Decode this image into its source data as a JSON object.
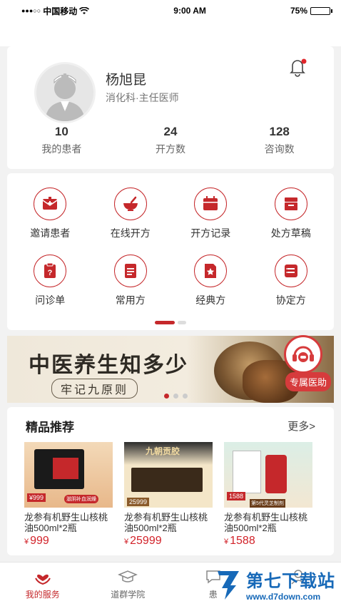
{
  "status_bar": {
    "signal": "●●●○○",
    "carrier": "中国移动",
    "time": "9:00 AM",
    "battery": "75%",
    "battery_level": 0.75
  },
  "profile": {
    "name": "杨旭昆",
    "title": "消化科·主任医师",
    "stats": [
      {
        "value": "10",
        "label": "我的患者"
      },
      {
        "value": "24",
        "label": "开方数"
      },
      {
        "value": "128",
        "label": "咨询数"
      }
    ]
  },
  "menu": [
    {
      "label": "邀请患者",
      "icon": "invite-patient-icon"
    },
    {
      "label": "在线开方",
      "icon": "mortar-bowl-icon"
    },
    {
      "label": "开方记录",
      "icon": "calendar-record-icon"
    },
    {
      "label": "处方草稿",
      "icon": "draft-box-icon"
    },
    {
      "label": "问诊单",
      "icon": "question-form-icon"
    },
    {
      "label": "常用方",
      "icon": "document-lines-icon"
    },
    {
      "label": "经典方",
      "icon": "star-document-icon"
    },
    {
      "label": "协定方",
      "icon": "agreement-list-icon"
    }
  ],
  "banner": {
    "title": "中医养生知多少",
    "subtitle": "牢记九原则"
  },
  "service": {
    "label": "专属医助"
  },
  "recommend": {
    "title": "精品推荐",
    "more": "更多>",
    "products": [
      {
        "name": "龙参有机野生山核桃油500ml*2瓶",
        "currency": "¥",
        "price": "999",
        "img_price": "¥999",
        "img_tag": "滋阴补血润燥"
      },
      {
        "name": "龙参有机野生山核桃油500ml*2瓶",
        "currency": "¥",
        "price": "25999",
        "img_price": "25999",
        "img_tag": "九朝贡胶"
      },
      {
        "name": "龙参有机野生山核桃油500ml*2瓶",
        "currency": "¥",
        "price": "1588",
        "img_price": "1588",
        "img_tag": "第5代灵芝制剂"
      }
    ]
  },
  "tabbar": [
    {
      "label": "我的服务",
      "icon": "heart-hands-icon",
      "active": true
    },
    {
      "label": "道群学院",
      "icon": "graduation-cap-icon",
      "active": false
    },
    {
      "label": "患",
      "icon": "chat-bubble-icon",
      "active": false
    },
    {
      "label": "",
      "icon": "person-icon",
      "active": false
    }
  ],
  "watermark": {
    "big": "第七下载站",
    "small": "www.d7down.com"
  },
  "colors": {
    "accent": "#c5282b",
    "price": "#d2232a",
    "watermark": "#1769b8"
  }
}
